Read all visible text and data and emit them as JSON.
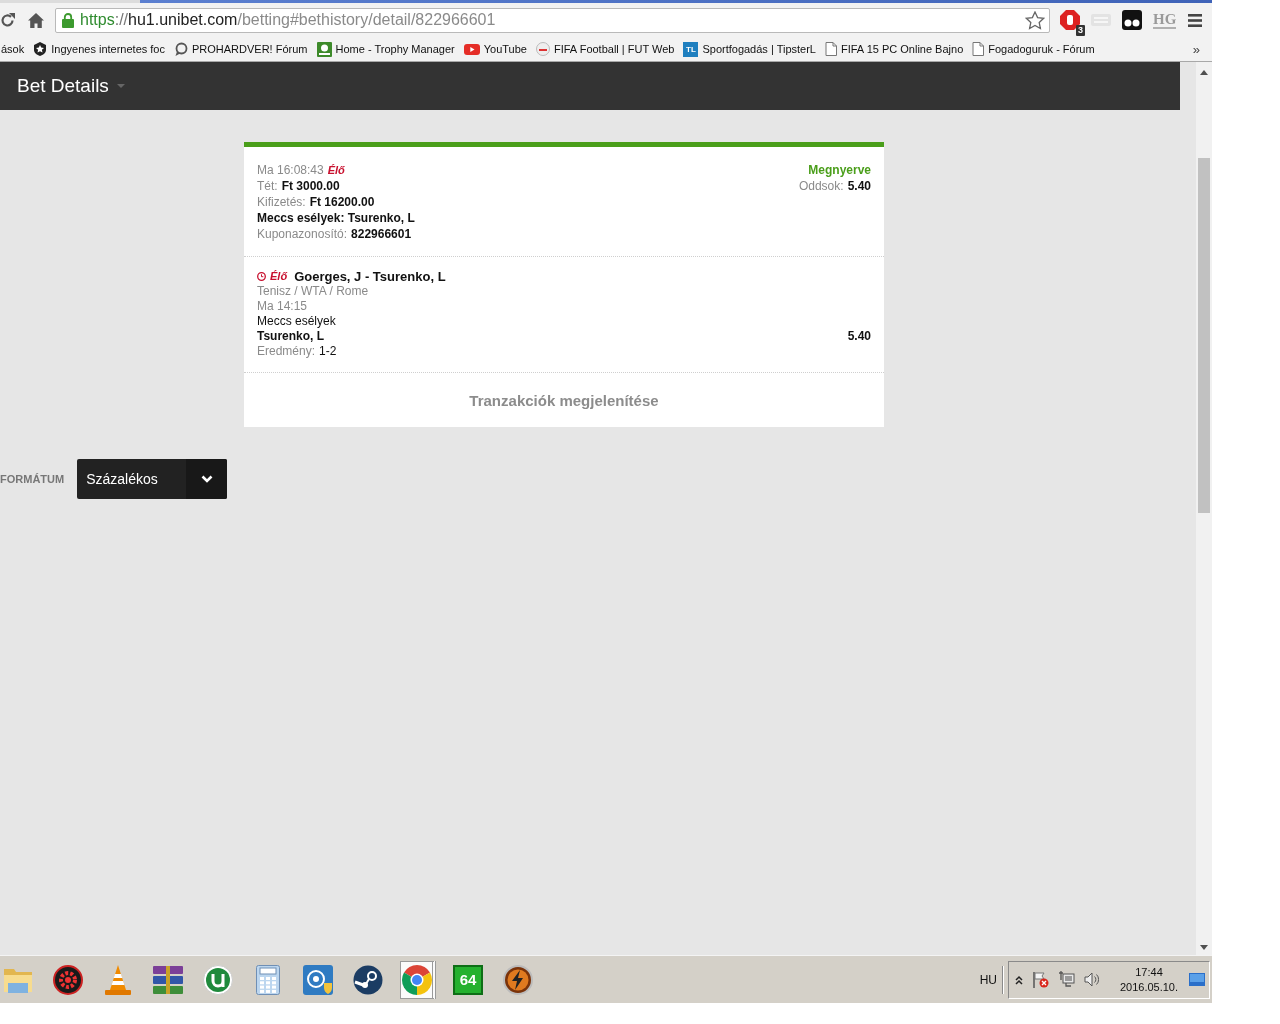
{
  "browser": {
    "address": {
      "scheme": "https",
      "separator": "://",
      "host": "hu1.unibet.com",
      "path": "/betting#bethistory/detail/822966601"
    },
    "extension_badge": "3",
    "extension_label": "HG"
  },
  "bookmarks": [
    {
      "label": "ások"
    },
    {
      "label": "Ingyenes internetes foc"
    },
    {
      "label": "PROHARDVER! Fórum"
    },
    {
      "label": "Home - Trophy Manager"
    },
    {
      "label": "YouTube"
    },
    {
      "label": "FIFA Football | FUT Web"
    },
    {
      "label": "Sportfogadás | TipsterL",
      "logo_text": "TL"
    },
    {
      "label": "FIFA 15 PC Online Bajno"
    },
    {
      "label": "Fogadoguruk - Fórum"
    }
  ],
  "bookmarks_overflow": "»",
  "page": {
    "title": "Bet Details"
  },
  "bet": {
    "placed": "Ma 16:08:43",
    "live_label": "Élő",
    "status": {
      "label": "Megnyerve",
      "kind": "won"
    },
    "odds_label": "Oddsok:",
    "odds": "5.40",
    "fields": [
      {
        "label": "Tét:",
        "value": "Ft 3000.00"
      },
      {
        "label": "Kifizetés:",
        "value": "Ft 16200.00"
      },
      {
        "value": "Meccs esélyek: Tsurenko, L"
      },
      {
        "label": "Kuponazonosító:",
        "value": "822966601"
      }
    ],
    "selections": [
      {
        "live_label": "Élő",
        "event": "Goerges, J - Tsurenko, L",
        "competition": "Tenisz / WTA / Rome",
        "start": "Ma 14:15",
        "market": "Meccs esélyek",
        "pick": "Tsurenko, L",
        "odds": "5.40",
        "result_label": "Eredmény:",
        "result": "1-2"
      }
    ],
    "transactions_link": "Tranzakciók megjelenítése"
  },
  "odds_format": {
    "label": "FORMÁTUM",
    "value": "Százalékos"
  },
  "taskbar": {
    "apps": [
      {
        "selected": false
      },
      {
        "selected": false
      },
      {
        "selected": false
      },
      {
        "selected": false
      },
      {
        "selected": false
      },
      {
        "selected": false
      },
      {
        "selected": false
      },
      {
        "selected": false
      },
      {
        "selected": true
      },
      {
        "selected": false,
        "logo_text": "64"
      },
      {
        "selected": false
      }
    ],
    "language": "HU",
    "time": "17:44",
    "date": "2016.05.10."
  }
}
